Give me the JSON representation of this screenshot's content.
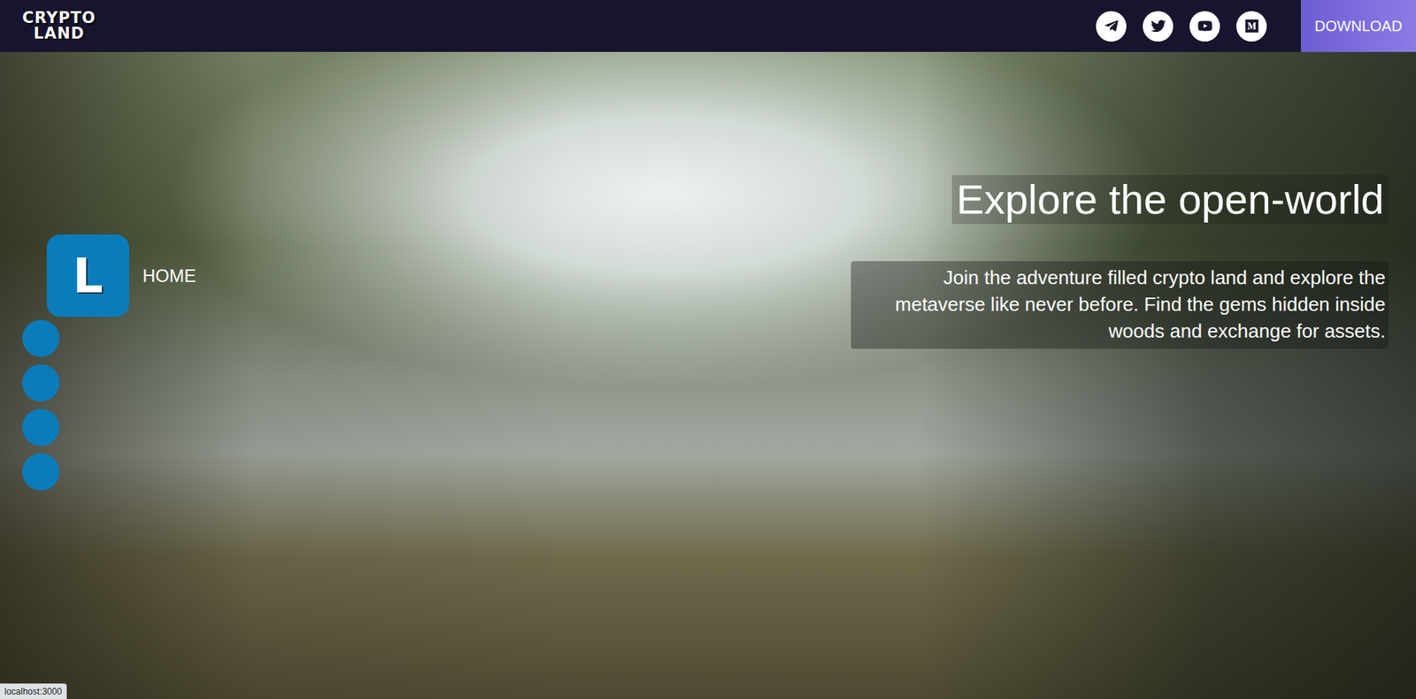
{
  "header": {
    "logo": [
      "CRYPTO",
      "LAND"
    ],
    "download": "DOWNLOAD"
  },
  "side_nav": {
    "items": [
      {
        "label": "HOME",
        "glyph": "L",
        "selected": true
      },
      {
        "label": "",
        "glyph": "",
        "selected": false
      },
      {
        "label": "",
        "glyph": "",
        "selected": false
      },
      {
        "label": "",
        "glyph": "",
        "selected": false
      },
      {
        "label": "",
        "glyph": "",
        "selected": false
      }
    ]
  },
  "hero": {
    "title": "Explore the open-world",
    "description": [
      "Join the adventure filled crypto land and explore the",
      "metaverse like never before. Find the gems hidden inside",
      "woods and exchange for assets."
    ]
  },
  "status_bar": "localhost:3000"
}
